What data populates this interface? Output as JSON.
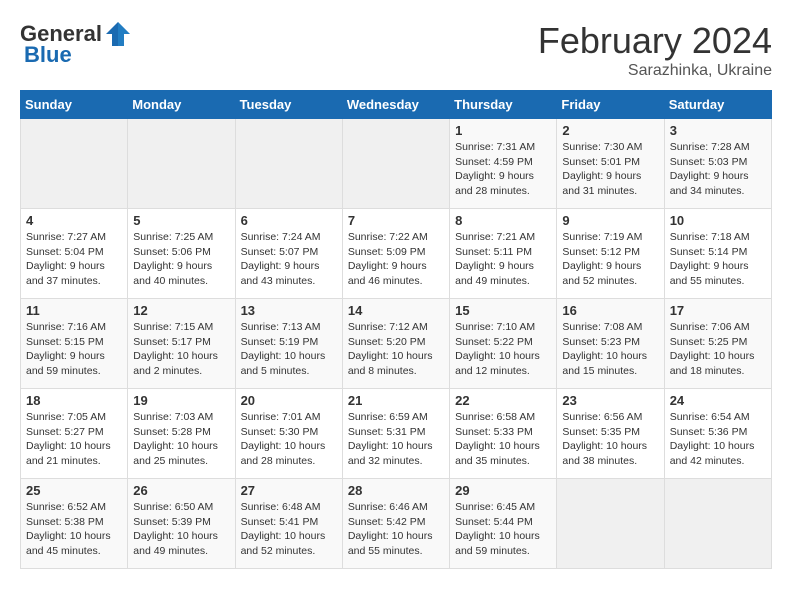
{
  "header": {
    "logo_general": "General",
    "logo_blue": "Blue",
    "month_year": "February 2024",
    "location": "Sarazhinka, Ukraine"
  },
  "days_of_week": [
    "Sunday",
    "Monday",
    "Tuesday",
    "Wednesday",
    "Thursday",
    "Friday",
    "Saturday"
  ],
  "weeks": [
    [
      {
        "day": "",
        "info": ""
      },
      {
        "day": "",
        "info": ""
      },
      {
        "day": "",
        "info": ""
      },
      {
        "day": "",
        "info": ""
      },
      {
        "day": "1",
        "info": "Sunrise: 7:31 AM\nSunset: 4:59 PM\nDaylight: 9 hours\nand 28 minutes."
      },
      {
        "day": "2",
        "info": "Sunrise: 7:30 AM\nSunset: 5:01 PM\nDaylight: 9 hours\nand 31 minutes."
      },
      {
        "day": "3",
        "info": "Sunrise: 7:28 AM\nSunset: 5:03 PM\nDaylight: 9 hours\nand 34 minutes."
      }
    ],
    [
      {
        "day": "4",
        "info": "Sunrise: 7:27 AM\nSunset: 5:04 PM\nDaylight: 9 hours\nand 37 minutes."
      },
      {
        "day": "5",
        "info": "Sunrise: 7:25 AM\nSunset: 5:06 PM\nDaylight: 9 hours\nand 40 minutes."
      },
      {
        "day": "6",
        "info": "Sunrise: 7:24 AM\nSunset: 5:07 PM\nDaylight: 9 hours\nand 43 minutes."
      },
      {
        "day": "7",
        "info": "Sunrise: 7:22 AM\nSunset: 5:09 PM\nDaylight: 9 hours\nand 46 minutes."
      },
      {
        "day": "8",
        "info": "Sunrise: 7:21 AM\nSunset: 5:11 PM\nDaylight: 9 hours\nand 49 minutes."
      },
      {
        "day": "9",
        "info": "Sunrise: 7:19 AM\nSunset: 5:12 PM\nDaylight: 9 hours\nand 52 minutes."
      },
      {
        "day": "10",
        "info": "Sunrise: 7:18 AM\nSunset: 5:14 PM\nDaylight: 9 hours\nand 55 minutes."
      }
    ],
    [
      {
        "day": "11",
        "info": "Sunrise: 7:16 AM\nSunset: 5:15 PM\nDaylight: 9 hours\nand 59 minutes."
      },
      {
        "day": "12",
        "info": "Sunrise: 7:15 AM\nSunset: 5:17 PM\nDaylight: 10 hours\nand 2 minutes."
      },
      {
        "day": "13",
        "info": "Sunrise: 7:13 AM\nSunset: 5:19 PM\nDaylight: 10 hours\nand 5 minutes."
      },
      {
        "day": "14",
        "info": "Sunrise: 7:12 AM\nSunset: 5:20 PM\nDaylight: 10 hours\nand 8 minutes."
      },
      {
        "day": "15",
        "info": "Sunrise: 7:10 AM\nSunset: 5:22 PM\nDaylight: 10 hours\nand 12 minutes."
      },
      {
        "day": "16",
        "info": "Sunrise: 7:08 AM\nSunset: 5:23 PM\nDaylight: 10 hours\nand 15 minutes."
      },
      {
        "day": "17",
        "info": "Sunrise: 7:06 AM\nSunset: 5:25 PM\nDaylight: 10 hours\nand 18 minutes."
      }
    ],
    [
      {
        "day": "18",
        "info": "Sunrise: 7:05 AM\nSunset: 5:27 PM\nDaylight: 10 hours\nand 21 minutes."
      },
      {
        "day": "19",
        "info": "Sunrise: 7:03 AM\nSunset: 5:28 PM\nDaylight: 10 hours\nand 25 minutes."
      },
      {
        "day": "20",
        "info": "Sunrise: 7:01 AM\nSunset: 5:30 PM\nDaylight: 10 hours\nand 28 minutes."
      },
      {
        "day": "21",
        "info": "Sunrise: 6:59 AM\nSunset: 5:31 PM\nDaylight: 10 hours\nand 32 minutes."
      },
      {
        "day": "22",
        "info": "Sunrise: 6:58 AM\nSunset: 5:33 PM\nDaylight: 10 hours\nand 35 minutes."
      },
      {
        "day": "23",
        "info": "Sunrise: 6:56 AM\nSunset: 5:35 PM\nDaylight: 10 hours\nand 38 minutes."
      },
      {
        "day": "24",
        "info": "Sunrise: 6:54 AM\nSunset: 5:36 PM\nDaylight: 10 hours\nand 42 minutes."
      }
    ],
    [
      {
        "day": "25",
        "info": "Sunrise: 6:52 AM\nSunset: 5:38 PM\nDaylight: 10 hours\nand 45 minutes."
      },
      {
        "day": "26",
        "info": "Sunrise: 6:50 AM\nSunset: 5:39 PM\nDaylight: 10 hours\nand 49 minutes."
      },
      {
        "day": "27",
        "info": "Sunrise: 6:48 AM\nSunset: 5:41 PM\nDaylight: 10 hours\nand 52 minutes."
      },
      {
        "day": "28",
        "info": "Sunrise: 6:46 AM\nSunset: 5:42 PM\nDaylight: 10 hours\nand 55 minutes."
      },
      {
        "day": "29",
        "info": "Sunrise: 6:45 AM\nSunset: 5:44 PM\nDaylight: 10 hours\nand 59 minutes."
      },
      {
        "day": "",
        "info": ""
      },
      {
        "day": "",
        "info": ""
      }
    ]
  ]
}
